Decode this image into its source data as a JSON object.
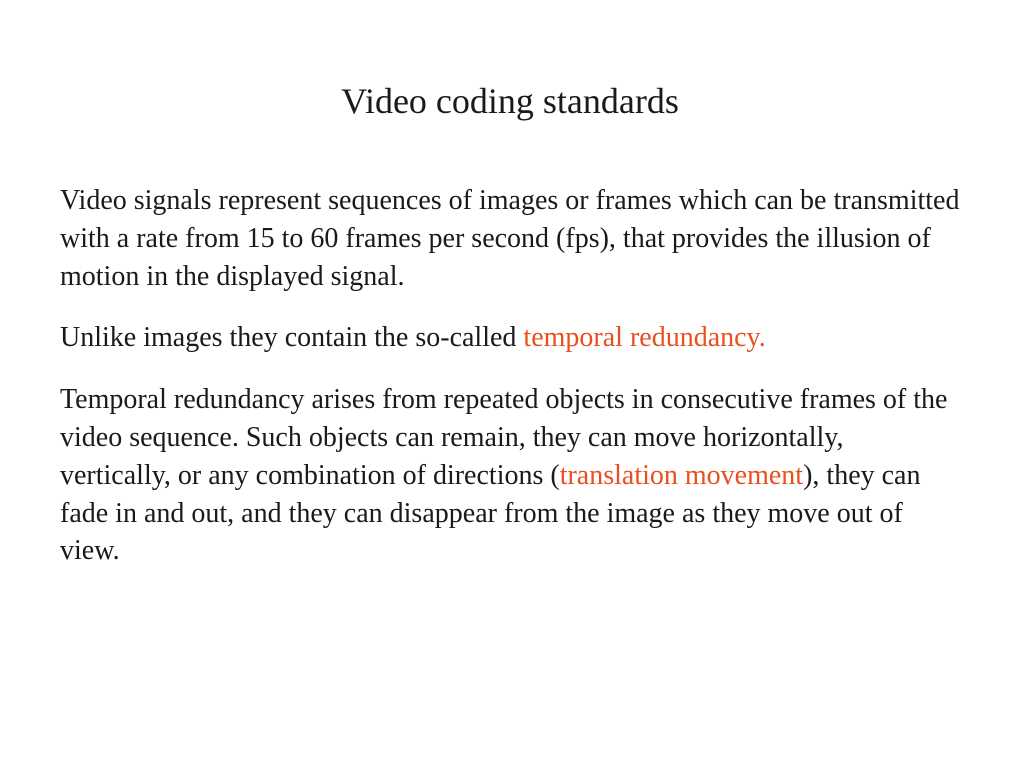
{
  "title": "Video coding standards",
  "paragraph1": "Video signals represent sequences of images or frames which can be transmitted with a rate from 15 to 60 frames per second (fps), that provides the illusion of motion in the displayed signal.",
  "paragraph2": {
    "before": "Unlike images they contain the so-called ",
    "highlight": "temporal redundancy."
  },
  "paragraph3": {
    "part1": "Temporal redundancy arises from repeated objects in consecutive frames of the video sequence. Such objects can remain, they can move horizontally, vertically, or any combination of directions (",
    "highlight": "translation movement",
    "part2": "), they can fade in and out, and they can disappear from the image as they move out of view."
  }
}
